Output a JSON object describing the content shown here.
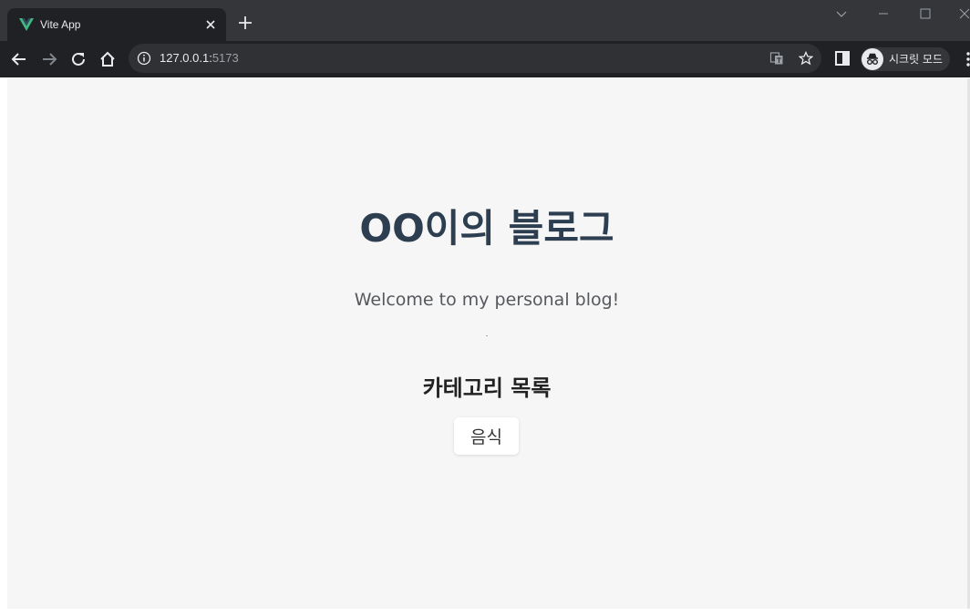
{
  "browser": {
    "tab_title": "Vite App",
    "url_host": "127.0.0.1:",
    "url_port": "5173",
    "incognito_label": "시크릿 모드",
    "colors": {
      "chrome_dark": "#35363a",
      "toolbar": "#202124",
      "vue_green": "#41b883"
    }
  },
  "page": {
    "title": "OO이의 블로그",
    "subtitle": "Welcome to my personal blog!",
    "category_heading": "카테고리 목록",
    "categories": [
      {
        "label": "음식"
      }
    ],
    "colors": {
      "background": "#f6f6f6",
      "title": "#2c3e50"
    }
  }
}
